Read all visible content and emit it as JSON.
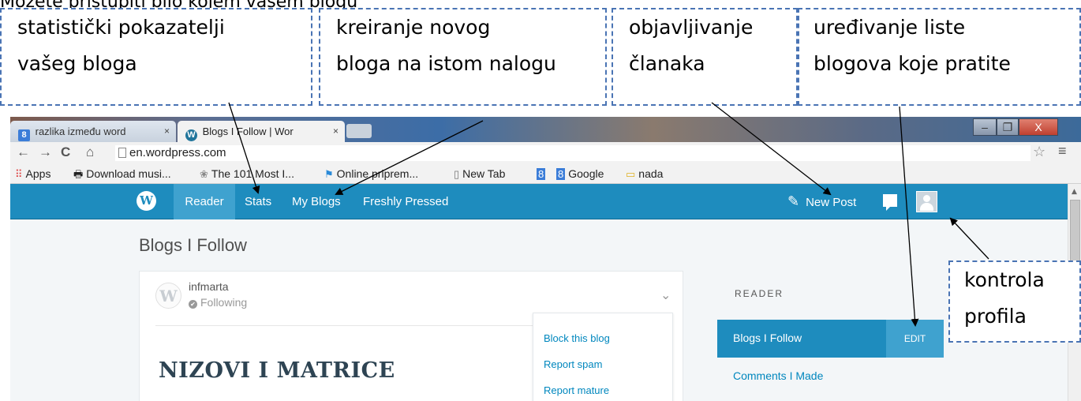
{
  "intro_text": "Možete pristupiti bilo kojem vašem blogu",
  "callouts": {
    "stats_line1": "statistički pokazatelji",
    "stats_line2": "vašeg bloga",
    "myblogs_line1": "kreiranje novog",
    "myblogs_line2": "bloga na istom nalogu",
    "newpost_line1": "objavljivanje",
    "newpost_line2": "članaka",
    "edit_line1": "uređivanje liste",
    "edit_line2": "blogova koje pratite",
    "profile_line1": "kontrola",
    "profile_line2": "profila"
  },
  "browser": {
    "tabs": [
      {
        "label": "razlika između word",
        "close": "×",
        "active": false
      },
      {
        "label": "Blogs I Follow | Wor",
        "close": "×",
        "active": true
      }
    ],
    "window_controls": {
      "minimize": "–",
      "maximize": "❐",
      "close": "X"
    },
    "nav": {
      "back": "←",
      "forward": "→",
      "reload": "C",
      "home": "⌂"
    },
    "url": "en.wordpress.com",
    "bookmarks": [
      {
        "icon": "apps-grid-icon",
        "label": "Apps"
      },
      {
        "icon": "download-icon",
        "label": "Download musi..."
      },
      {
        "icon": "flower-icon",
        "label": "The 101 Most I..."
      },
      {
        "icon": "runner-icon",
        "label": "Online priprem..."
      },
      {
        "icon": "page-icon",
        "label": "New Tab"
      },
      {
        "icon": "google-icon",
        "label": ""
      },
      {
        "icon": "google-icon",
        "label": "Google"
      },
      {
        "icon": "folder-icon",
        "label": "nada"
      }
    ]
  },
  "wp": {
    "logo": "W",
    "nav": {
      "reader": "Reader",
      "stats": "Stats",
      "my_blogs": "My Blogs",
      "freshly_pressed": "Freshly Pressed"
    },
    "new_post": "New Post",
    "page_title": "Blogs I Follow",
    "post": {
      "blog_name": "infmarta",
      "follow_status": "Following",
      "title": "NIZOVI I MATRICE"
    },
    "post_menu": [
      "Block this blog",
      "Report spam",
      "Report mature"
    ],
    "sidebar": {
      "heading": "READER",
      "active_item": "Blogs I Follow",
      "edit_label": "EDIT",
      "items": [
        "Comments I Made"
      ]
    }
  },
  "colors": {
    "wp_blue": "#1e8cbe",
    "wp_active": "#3fa2cf",
    "link_blue": "#0087be",
    "callout_border": "#4a74b4"
  }
}
